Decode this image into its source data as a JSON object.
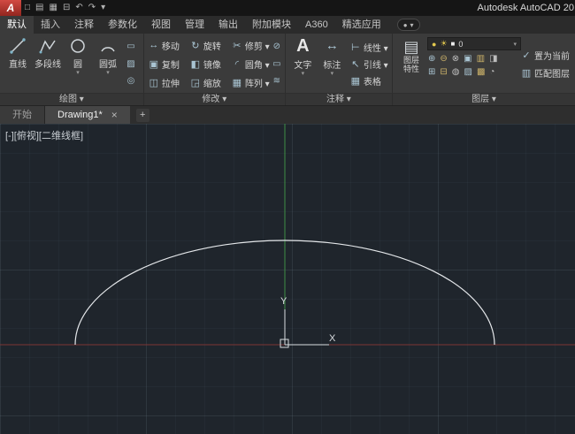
{
  "glyphs": {
    "dd": "▾",
    "dot": "●"
  },
  "titlebar": {
    "logo": "A",
    "qat": [
      "□",
      "▤",
      "▦",
      "⊟",
      "↶",
      "↷",
      "▾"
    ],
    "title": "Autodesk AutoCAD 20"
  },
  "tabs": {
    "items": [
      {
        "label": "默认"
      },
      {
        "label": "插入"
      },
      {
        "label": "注释"
      },
      {
        "label": "参数化"
      },
      {
        "label": "视图"
      },
      {
        "label": "管理"
      },
      {
        "label": "输出"
      },
      {
        "label": "附加模块"
      },
      {
        "label": "A360"
      },
      {
        "label": "精选应用"
      }
    ]
  },
  "draw_panel": {
    "label": "绘图 ▾",
    "tools": [
      {
        "label": "直线"
      },
      {
        "label": "多段线"
      },
      {
        "label": "圆",
        "dd": "▾"
      },
      {
        "label": "圆弧",
        "dd": "▾"
      }
    ],
    "side_icons": [
      "▭",
      "▨",
      "◎"
    ]
  },
  "modify_panel": {
    "label": "修改 ▾",
    "tools": [
      {
        "icon": "↔",
        "label": "移动"
      },
      {
        "icon": "↻",
        "label": "旋转"
      },
      {
        "icon": "✂",
        "label": "修剪 ▾"
      },
      {
        "icon": "▣",
        "label": "复制"
      },
      {
        "icon": "◧",
        "label": "镜像"
      },
      {
        "icon": "◜",
        "label": "圆角 ▾"
      },
      {
        "icon": "◫",
        "label": "拉伸"
      },
      {
        "icon": "◲",
        "label": "缩放"
      },
      {
        "icon": "▦",
        "label": "阵列 ▾"
      }
    ],
    "side_icons": [
      "⊘",
      "▭",
      "≋"
    ]
  },
  "annotation_panel": {
    "label": "注释 ▾",
    "text_tool": {
      "icon": "A",
      "label": "文字",
      "dd": "▾"
    },
    "dim_tool": {
      "icon": "↔",
      "label": "标注",
      "dd": "▾"
    },
    "rows": [
      {
        "icon": "⊢",
        "label": "线性 ▾"
      },
      {
        "icon": "↖",
        "label": "引线 ▾"
      },
      {
        "icon": "▦",
        "label": "表格"
      }
    ]
  },
  "layers_panel": {
    "label": "图层 ▾",
    "properties": {
      "icon": "▤",
      "label_line1": "图层",
      "label_line2": "特性"
    },
    "dropdown": {
      "bulb": "●",
      "sun": "☀",
      "swatch": "■",
      "name": "0",
      "dd": "▾"
    },
    "icon_row1": [
      "⊕",
      "⊖",
      "⊗",
      "▣",
      "▥",
      "◨"
    ],
    "icon_row2": [
      "⊞",
      "⊟",
      "◍",
      "▨",
      "▩",
      "◔"
    ],
    "set_current": {
      "icon": "✓",
      "label": "置为当前"
    },
    "match": {
      "icon": "▥",
      "label": "匹配图层"
    }
  },
  "file_tabs": {
    "start": "开始",
    "drawing": "Drawing1*",
    "close": "×",
    "add": "+"
  },
  "canvas": {
    "viewport_label": "[-][俯视][二维线框]",
    "x_label": "X",
    "y_label": "Y",
    "colors": {
      "y_axis": "#3f8f46",
      "x_axis": "#7d3535",
      "curve": "#e4e7ea",
      "ucs": "#d9dde0"
    }
  }
}
